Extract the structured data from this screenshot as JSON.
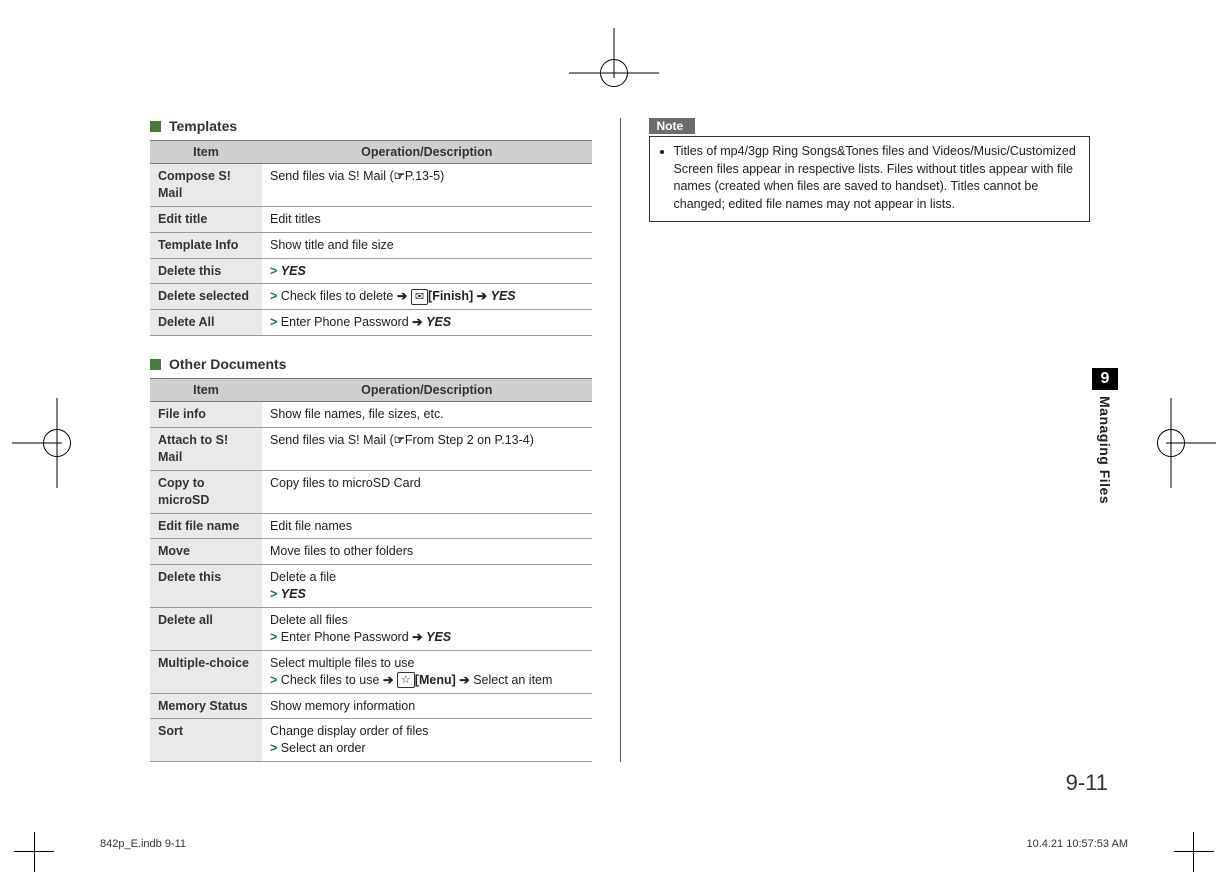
{
  "sections": {
    "templates": {
      "title": "Templates",
      "headers": [
        "Item",
        "Operation/Description"
      ]
    },
    "other": {
      "title": "Other Documents",
      "headers": [
        "Item",
        "Operation/Description"
      ]
    }
  },
  "templates_rows": {
    "r0": {
      "label": "Compose S! Mail",
      "desc_pre": "Send files via S! Mail (",
      "ref": "P.13-5",
      "desc_post": ")"
    },
    "r1": {
      "label": "Edit title",
      "desc": "Edit titles"
    },
    "r2": {
      "label": "Template Info",
      "desc": "Show title and file size"
    },
    "r3": {
      "label": "Delete this",
      "yes": "YES"
    },
    "r4": {
      "label": "Delete selected",
      "step1": "Check files to delete",
      "key": "✉",
      "key_label": "[Finish]",
      "yes": "YES"
    },
    "r5": {
      "label": "Delete All",
      "step1": "Enter Phone Password",
      "yes": "YES"
    }
  },
  "other_rows": {
    "r0": {
      "label": "File info",
      "desc": "Show file names, file sizes, etc."
    },
    "r1": {
      "label": "Attach to S! Mail",
      "desc_pre": "Send files via S! Mail (",
      "ref": "From Step 2 on P.13-4",
      "desc_post": ")"
    },
    "r2": {
      "label": "Copy to microSD",
      "desc": "Copy files to microSD Card"
    },
    "r3": {
      "label": "Edit file name",
      "desc": "Edit file names"
    },
    "r4": {
      "label": "Move",
      "desc": "Move files to other folders"
    },
    "r5": {
      "label": "Delete this",
      "desc": "Delete a file",
      "yes": "YES"
    },
    "r6": {
      "label": "Delete all",
      "desc": "Delete all files",
      "step1": "Enter Phone Password",
      "yes": "YES"
    },
    "r7": {
      "label": "Multiple-choice",
      "desc": "Select multiple files to use",
      "step1": "Check files to use",
      "key": "☆",
      "key_label": "[Menu]",
      "step2": "Select an item"
    },
    "r8": {
      "label": "Memory Status",
      "desc": "Show memory information"
    },
    "r9": {
      "label": "Sort",
      "desc": "Change display order of files",
      "step1": "Select an order"
    }
  },
  "note": {
    "label": "Note",
    "body": "Titles of mp4/3gp Ring Songs&Tones files and Videos/Music/Customized Screen files appear in respective lists. Files without titles appear with file names (created when files are saved to handset). Titles cannot be changed; edited file names may not appear in lists."
  },
  "side": {
    "chapter": "9",
    "title": "Managing Files"
  },
  "page_number": "9-11",
  "footer": {
    "left": "842p_E.indb   9-11",
    "right": "10.4.21   10:57:53 AM"
  },
  "glyphs": {
    "arrow": "➔",
    "hand": "☞",
    "gt": ">"
  }
}
